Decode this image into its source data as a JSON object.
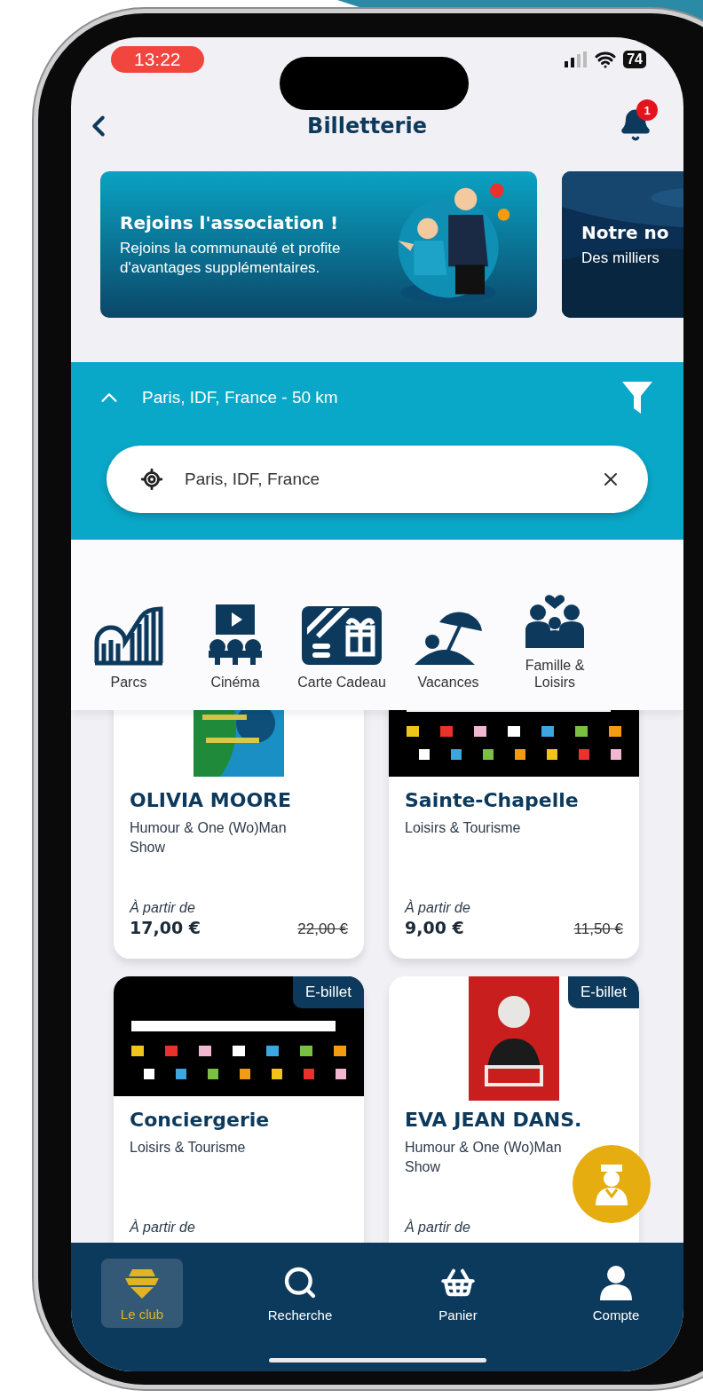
{
  "status_bar": {
    "time": "13:22",
    "battery": "74"
  },
  "header": {
    "title": "Billetterie",
    "notifications": "1"
  },
  "banners": [
    {
      "kind": "illustration",
      "title": "Rejoins l'association !",
      "text": "Rejoins la communauté et profite d'avantages supplémentaires."
    },
    {
      "kind": "picture",
      "title": "Notre no",
      "text": "Des milliers"
    }
  ],
  "location": {
    "summary": "Paris, IDF, France - 50 km",
    "expanded": true,
    "search": {
      "value": "Paris, IDF, France"
    }
  },
  "categories": [
    {
      "label": "Parcs"
    },
    {
      "label": "Cinéma"
    },
    {
      "label": "Carte Cadeau"
    },
    {
      "label": "Vacances"
    },
    {
      "label": "Famille & Loisirs"
    }
  ],
  "cards": [
    {
      "title": "OLIVIA MOORE",
      "category": "Humour & One (Wo)Man Show",
      "from_label": "À partir de",
      "price": "17,00 €",
      "old_price": "22,00 €"
    },
    {
      "title": "Sainte-Chapelle",
      "category": "Loisirs & Tourisme",
      "from_label": "À partir de",
      "price": "9,00 €",
      "old_price": "11,50 €"
    },
    {
      "title": "Conciergerie",
      "category": "Loisirs & Tourisme",
      "from_label": "À partir de",
      "badge": "E-billet"
    },
    {
      "title": "EVA JEAN DANS.",
      "category": "Humour & One (Wo)Man Show",
      "from_label": "À partir de",
      "badge": "E-billet"
    }
  ],
  "nav": [
    {
      "label": "Le club",
      "selected": true
    },
    {
      "label": "Recherche",
      "selected": false
    },
    {
      "label": "Panier",
      "selected": false
    },
    {
      "label": "Compte",
      "selected": false
    }
  ]
}
